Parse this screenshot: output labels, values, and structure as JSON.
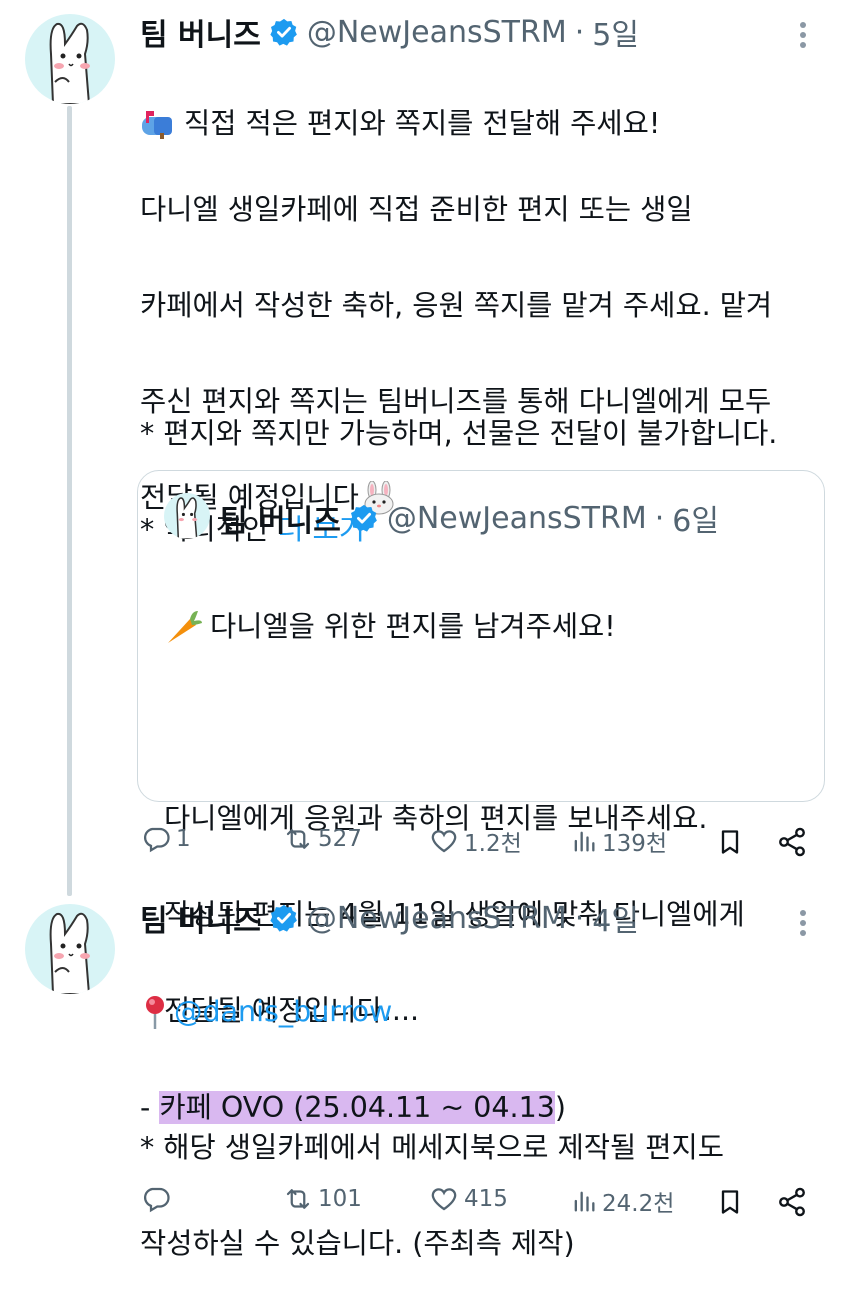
{
  "colors": {
    "link": "#1d9bf0",
    "muted": "#536471",
    "verified": "#1d9bf0",
    "highlight": "#d9b8f0"
  },
  "tweet1": {
    "name": "팀 버니즈",
    "handle": "@NewJeansSTRM",
    "time": "5일",
    "line1": "직접 적은 편지와 쪽지를 전달해 주세요!",
    "body_lines": [
      "다니엘 생일카페에 직접 준비한 편지 또는 생일",
      "카페에서 작성한 축하, 응원 쪽지를 맡겨 주세요. 맡겨",
      "주신 편지와 쪽지는 팀버니즈를 통해 다니엘에게 모두",
      "전달될 예정입니다"
    ],
    "note1": "* 편지와 쪽지만 가능하며, 선물은 전달이 불가합니다.",
    "note2": "* 악의적인",
    "more": "더 보기",
    "quote": {
      "name": "팀 버니즈",
      "handle": "@NewJeansSTRM",
      "time": "6일",
      "line1": "다니엘을 위한 편지를 남겨주세요!",
      "lines": [
        "다니엘에게 응원과 축하의 편지를 보내주세요.",
        "작성된 편지는 4월 11일 생일에 맞춰 다니엘에게",
        "전달될 예정입니다...."
      ]
    },
    "actions": {
      "reply": "1",
      "retweet": "527",
      "like": "1.2천",
      "views": "139천"
    }
  },
  "tweet2": {
    "name": "팀 버니즈",
    "handle": "@NewJeansSTRM",
    "time": "4일",
    "mention": "@danis_burrow",
    "cafe_prefix": "- ",
    "cafe_highlighted": "카페 OVO (25.04.11 ~ 04.13",
    "cafe_suffix": ")",
    "note_lines": [
      "* 해당 생일카페에서 메세지북으로 제작될 편지도",
      "작성하실 수 있습니다. (주최측 제작)"
    ],
    "actions": {
      "reply": "",
      "retweet": "101",
      "like": "415",
      "views": "24.2천"
    }
  },
  "icons": [
    "mailbox-icon",
    "verified-badge-icon",
    "rabbit-face-icon",
    "carrot-icon",
    "pushpin-icon",
    "reply-icon",
    "retweet-icon",
    "like-icon",
    "views-icon",
    "bookmark-icon",
    "share-icon",
    "more-options-icon"
  ]
}
